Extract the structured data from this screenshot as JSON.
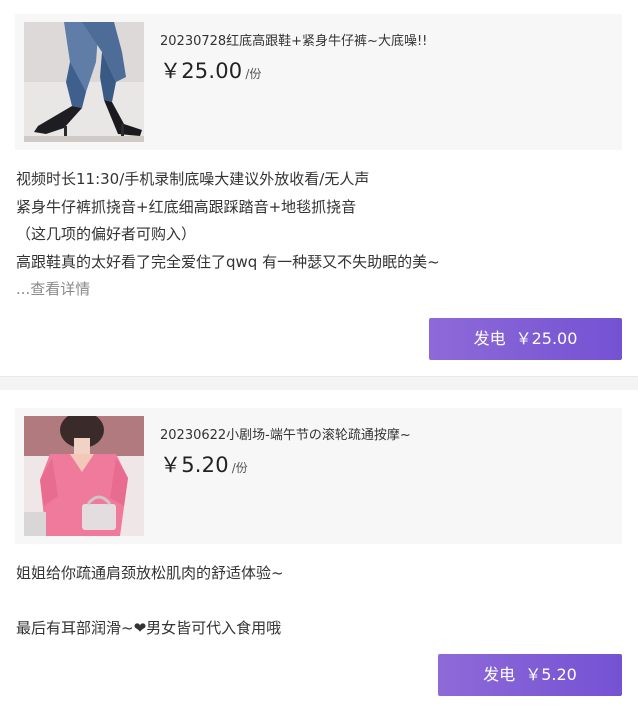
{
  "items": [
    {
      "title": "20230728红底高跟鞋+紧身牛仔裤~大底噪!!",
      "price": "￥25.00",
      "unit": "/份",
      "thumbnail_icon": "photo-jeans-heels",
      "description": [
        "视频时长11:30/手机录制底噪大建议外放收看/无人声",
        "紧身牛仔裤抓挠音+红底细高跟踩踏音+地毯抓挠音",
        "（这几项的偏好者可购入）",
        "高跟鞋真的太好看了完全爱住了qwq 有一种瑟又不失助眠的美~"
      ],
      "more_label": "...查看详情",
      "button": {
        "label": "发电",
        "price": "￥25.00"
      }
    },
    {
      "title": "20230622小剧场-端午节の滚轮疏通按摩~",
      "price": "￥5.20",
      "unit": "/份",
      "thumbnail_icon": "photo-pink-dress",
      "description": [
        "姐姐给你疏通肩颈放松肌肉的舒适体验~",
        "",
        "最后有耳部润滑~❤男女皆可代入食用哦"
      ],
      "button": {
        "label": "发电",
        "price": "￥5.20"
      }
    }
  ],
  "colors": {
    "button_gradient_start": "#8e6ad8",
    "button_gradient_end": "#7452d3",
    "product_bg": "#f7f7f8",
    "more_link": "#8a8a8a"
  }
}
